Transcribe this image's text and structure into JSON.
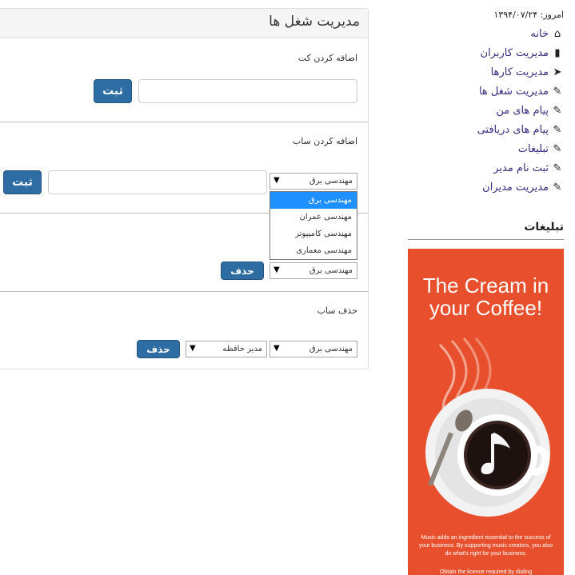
{
  "panel": {
    "title": "مدیریت شغل ها",
    "add_cat_label": "اضافه کردن کت",
    "add_cat_submit": "ثبت",
    "add_sub_label": "اضافه کردن ساب",
    "add_sub_selected": "مهندسی برق",
    "add_sub_submit": "ثبت",
    "dropdown_options": [
      "مهندسی برق",
      "مهندسی عمران",
      "مهندسی کامپیوتر",
      "مهندسی معماری"
    ],
    "delete_cat_selected": "مهندسی برق",
    "delete_cat_button": "حذف",
    "delete_sub_label": "حذف ساب",
    "delete_sub_cat_selected": "مهندسی برق",
    "delete_sub_sub_selected": "مدیر حافظه",
    "delete_sub_button": "حذف"
  },
  "sidebar": {
    "date": "امروز: ۱۳۹۴/۰۷/۲۴",
    "nav": [
      {
        "label": "خانه",
        "icon": "home-icon"
      },
      {
        "label": "مدیریت کاربران",
        "icon": "book-icon"
      },
      {
        "label": "مدیریت کارها",
        "icon": "send-icon"
      },
      {
        "label": "مدیریت شغل ها",
        "icon": "paperclip-icon"
      },
      {
        "label": "پیام های من",
        "icon": "paperclip-icon"
      },
      {
        "label": "پیام های دریافتی",
        "icon": "paperclip-icon"
      },
      {
        "label": "تبلیغات",
        "icon": "paperclip-icon"
      },
      {
        "label": "ثبت نام مدیر",
        "icon": "paperclip-icon"
      },
      {
        "label": "مدیریت مدیران",
        "icon": "paperclip-icon"
      }
    ],
    "ads_title": "تبلیغات"
  },
  "ad": {
    "headline": "The Cream in your Coffee!",
    "body": "Music adds an ingredient essential to the success of your business. By supporting music creators, you also do what's right for your business.",
    "footer": "Obtain the licence required by dialing",
    "colors": {
      "background": "#e8502d",
      "text": "#ffffff"
    }
  }
}
